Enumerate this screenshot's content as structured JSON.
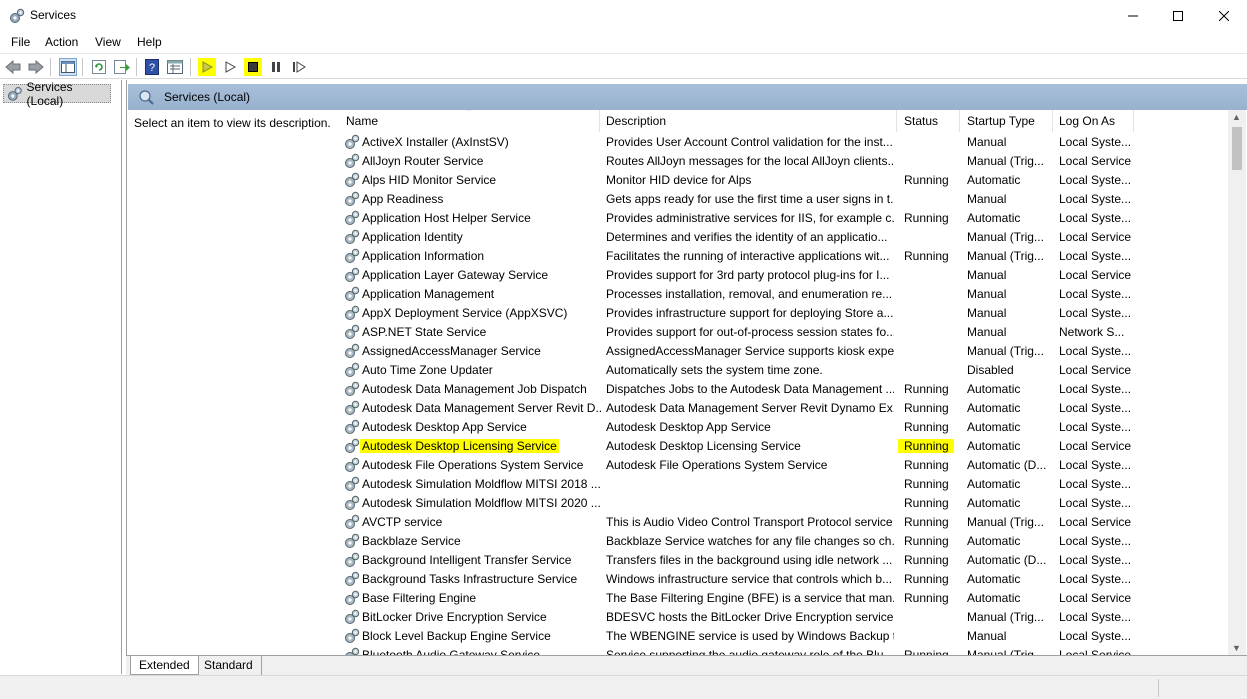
{
  "window": {
    "title": "Services"
  },
  "menu": [
    "File",
    "Action",
    "View",
    "Help"
  ],
  "tree": {
    "root_label": "Services (Local)"
  },
  "main": {
    "header_label": "Services (Local)",
    "description_prompt": "Select an item to view its description."
  },
  "columns": {
    "name": "Name",
    "description": "Description",
    "status": "Status",
    "startup": "Startup Type",
    "logon": "Log On As"
  },
  "rows": [
    {
      "name": "ActiveX Installer (AxInstSV)",
      "description": "Provides User Account Control validation for the inst...",
      "status": "",
      "startup": "Manual",
      "logon": "Local Syste..."
    },
    {
      "name": "AllJoyn Router Service",
      "description": "Routes AllJoyn messages for the local AllJoyn clients...",
      "status": "",
      "startup": "Manual (Trig...",
      "logon": "Local Service"
    },
    {
      "name": "Alps HID Monitor Service",
      "description": "Monitor HID device for Alps",
      "status": "Running",
      "startup": "Automatic",
      "logon": "Local Syste..."
    },
    {
      "name": "App Readiness",
      "description": "Gets apps ready for use the first time a user signs in t...",
      "status": "",
      "startup": "Manual",
      "logon": "Local Syste..."
    },
    {
      "name": "Application Host Helper Service",
      "description": "Provides administrative services for IIS, for example c...",
      "status": "Running",
      "startup": "Automatic",
      "logon": "Local Syste..."
    },
    {
      "name": "Application Identity",
      "description": "Determines and verifies the identity of an applicatio...",
      "status": "",
      "startup": "Manual (Trig...",
      "logon": "Local Service"
    },
    {
      "name": "Application Information",
      "description": "Facilitates the running of interactive applications wit...",
      "status": "Running",
      "startup": "Manual (Trig...",
      "logon": "Local Syste..."
    },
    {
      "name": "Application Layer Gateway Service",
      "description": "Provides support for 3rd party protocol plug-ins for I...",
      "status": "",
      "startup": "Manual",
      "logon": "Local Service"
    },
    {
      "name": "Application Management",
      "description": "Processes installation, removal, and enumeration re...",
      "status": "",
      "startup": "Manual",
      "logon": "Local Syste..."
    },
    {
      "name": "AppX Deployment Service (AppXSVC)",
      "description": "Provides infrastructure support for deploying Store a...",
      "status": "",
      "startup": "Manual",
      "logon": "Local Syste..."
    },
    {
      "name": "ASP.NET State Service",
      "description": "Provides support for out-of-process session states fo...",
      "status": "",
      "startup": "Manual",
      "logon": "Network S..."
    },
    {
      "name": "AssignedAccessManager Service",
      "description": "AssignedAccessManager Service supports kiosk expe...",
      "status": "",
      "startup": "Manual (Trig...",
      "logon": "Local Syste..."
    },
    {
      "name": "Auto Time Zone Updater",
      "description": "Automatically sets the system time zone.",
      "status": "",
      "startup": "Disabled",
      "logon": "Local Service"
    },
    {
      "name": "Autodesk Data Management Job Dispatch",
      "description": "Dispatches Jobs to the Autodesk Data Management ...",
      "status": "Running",
      "startup": "Automatic",
      "logon": "Local Syste..."
    },
    {
      "name": "Autodesk Data Management Server Revit D...",
      "description": "Autodesk Data Management Server Revit Dynamo Ex...",
      "status": "Running",
      "startup": "Automatic",
      "logon": "Local Syste..."
    },
    {
      "name": "Autodesk Desktop App Service",
      "description": "Autodesk Desktop App Service",
      "status": "Running",
      "startup": "Automatic",
      "logon": "Local Syste..."
    },
    {
      "name": "Autodesk Desktop Licensing Service",
      "description": "Autodesk Desktop Licensing Service",
      "status": "Running",
      "startup": "Automatic",
      "logon": "Local Service",
      "highlighted": true
    },
    {
      "name": "Autodesk File Operations System Service",
      "description": "Autodesk File Operations System Service",
      "status": "Running",
      "startup": "Automatic (D...",
      "logon": "Local Syste..."
    },
    {
      "name": "Autodesk Simulation Moldflow MITSI 2018 ...",
      "description": "",
      "status": "Running",
      "startup": "Automatic",
      "logon": "Local Syste..."
    },
    {
      "name": "Autodesk Simulation Moldflow MITSI 2020 ...",
      "description": "",
      "status": "Running",
      "startup": "Automatic",
      "logon": "Local Syste..."
    },
    {
      "name": "AVCTP service",
      "description": "This is Audio Video Control Transport Protocol service",
      "status": "Running",
      "startup": "Manual (Trig...",
      "logon": "Local Service"
    },
    {
      "name": "Backblaze Service",
      "description": "Backblaze Service watches for any file changes so ch...",
      "status": "Running",
      "startup": "Automatic",
      "logon": "Local Syste..."
    },
    {
      "name": "Background Intelligent Transfer Service",
      "description": "Transfers files in the background using idle network ...",
      "status": "Running",
      "startup": "Automatic (D...",
      "logon": "Local Syste..."
    },
    {
      "name": "Background Tasks Infrastructure Service",
      "description": "Windows infrastructure service that controls which b...",
      "status": "Running",
      "startup": "Automatic",
      "logon": "Local Syste..."
    },
    {
      "name": "Base Filtering Engine",
      "description": "The Base Filtering Engine (BFE) is a service that man...",
      "status": "Running",
      "startup": "Automatic",
      "logon": "Local Service"
    },
    {
      "name": "BitLocker Drive Encryption Service",
      "description": "BDESVC hosts the BitLocker Drive Encryption service....",
      "status": "",
      "startup": "Manual (Trig...",
      "logon": "Local Syste..."
    },
    {
      "name": "Block Level Backup Engine Service",
      "description": "The WBENGINE service is used by Windows Backup t...",
      "status": "",
      "startup": "Manual",
      "logon": "Local Syste..."
    },
    {
      "name": "Bluetooth Audio Gateway Service",
      "description": "Service supporting the audio gateway role of the Blu...",
      "status": "Running",
      "startup": "Manual (Trig...",
      "logon": "Local Service"
    }
  ],
  "tabs": [
    "Extended",
    "Standard"
  ],
  "colors": {
    "highlight": "#ffff00",
    "header_band": "#a8bfd8"
  }
}
